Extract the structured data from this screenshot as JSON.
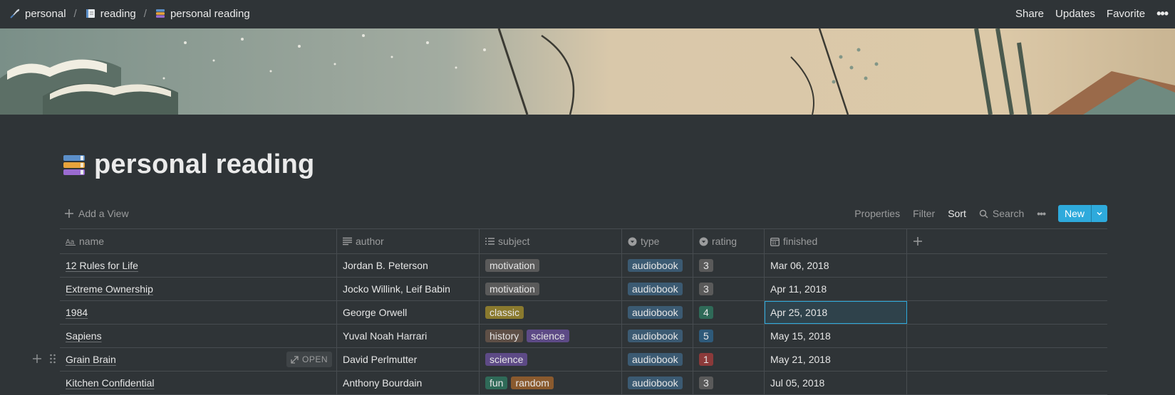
{
  "breadcrumb": {
    "items": [
      {
        "label": "personal",
        "icon": "quill-icon"
      },
      {
        "label": "reading",
        "icon": "notebook-icon"
      },
      {
        "label": "personal reading",
        "icon": "books-icon"
      }
    ],
    "separator": "/"
  },
  "top_actions": {
    "share": "Share",
    "updates": "Updates",
    "favorite": "Favorite",
    "more": "•••"
  },
  "page": {
    "title": "personal reading",
    "icon": "books-icon"
  },
  "toolbar": {
    "add_view": "Add a View",
    "properties": "Properties",
    "filter": "Filter",
    "sort": "Sort",
    "search": "Search",
    "more": "•••",
    "new": "New"
  },
  "table": {
    "columns": [
      {
        "label": "name",
        "icon": "title-aa-icon"
      },
      {
        "label": "author",
        "icon": "text-lines-icon"
      },
      {
        "label": "subject",
        "icon": "multi-select-list-icon"
      },
      {
        "label": "type",
        "icon": "select-circle-icon"
      },
      {
        "label": "rating",
        "icon": "select-circle-icon"
      },
      {
        "label": "finished",
        "icon": "calendar-icon"
      }
    ],
    "open_label": "OPEN",
    "rows": [
      {
        "name": "12 Rules for Life",
        "author": "Jordan B. Peterson",
        "subject": [
          {
            "label": "motivation",
            "color": "#5a5a5a"
          }
        ],
        "type": "audiobook",
        "rating": "3",
        "rating_color": "#5a5a5a",
        "finished": "Mar 06, 2018"
      },
      {
        "name": "Extreme Ownership",
        "author": "Jocko Willink, Leif Babin",
        "subject": [
          {
            "label": "motivation",
            "color": "#5a5a5a"
          }
        ],
        "type": "audiobook",
        "rating": "3",
        "rating_color": "#5a5a5a",
        "finished": "Apr 11, 2018"
      },
      {
        "name": "1984",
        "author": "George Orwell",
        "subject": [
          {
            "label": "classic",
            "color": "#8a7a2e"
          }
        ],
        "type": "audiobook",
        "rating": "4",
        "rating_color": "#2f6a58",
        "finished": "Apr 25, 2018"
      },
      {
        "name": "Sapiens",
        "author": "Yuval Noah Harrari",
        "subject": [
          {
            "label": "history",
            "color": "#5e4f46"
          },
          {
            "label": "science",
            "color": "#5d4a86"
          }
        ],
        "type": "audiobook",
        "rating": "5",
        "rating_color": "#2e5a7a",
        "finished": "May 15, 2018"
      },
      {
        "name": "Grain Brain",
        "author": "David Perlmutter",
        "subject": [
          {
            "label": "science",
            "color": "#5d4a86"
          }
        ],
        "type": "audiobook",
        "rating": "1",
        "rating_color": "#8b3a3a",
        "finished": "May 21, 2018"
      },
      {
        "name": "Kitchen Confidential",
        "author": "Anthony Bourdain",
        "subject": [
          {
            "label": "fun",
            "color": "#2f6a58"
          },
          {
            "label": "random",
            "color": "#8a5a2e"
          }
        ],
        "type": "audiobook",
        "rating": "3",
        "rating_color": "#5a5a5a",
        "finished": "Jul 05, 2018"
      }
    ]
  },
  "colors": {
    "accent": "#2eaadc",
    "type_tag": "#3b5a72",
    "background": "#2f3437"
  }
}
